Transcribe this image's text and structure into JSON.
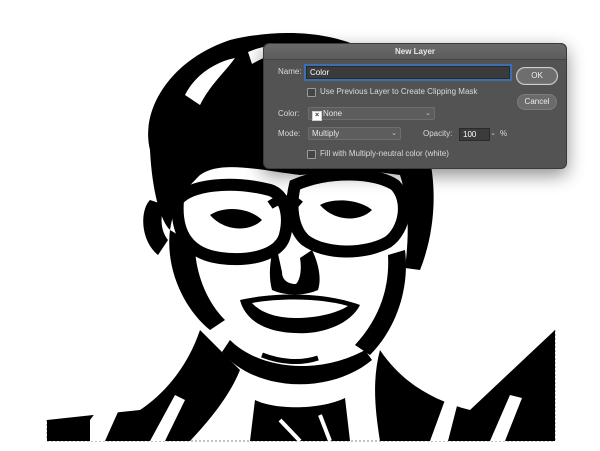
{
  "dialog": {
    "title": "New Layer",
    "name_label": "Name:",
    "name_value": "Color",
    "clipping_mask_label": "Use Previous Layer to Create Clipping Mask",
    "clipping_mask_checked": false,
    "color_label": "Color:",
    "color_value": "None",
    "mode_label": "Mode:",
    "mode_value": "Multiply",
    "opacity_label": "Opacity:",
    "opacity_value": "100",
    "opacity_unit": "%",
    "fill_label": "Fill with Multiply-neutral color (white)",
    "fill_checked": false,
    "ok_label": "OK",
    "cancel_label": "Cancel"
  },
  "icons": {
    "chevron": "⌄",
    "none_swatch": "x-swatch-icon"
  },
  "colors": {
    "dialog_bg": "#535353",
    "focus_ring": "#3d6fb0",
    "artwork": "#000000"
  }
}
